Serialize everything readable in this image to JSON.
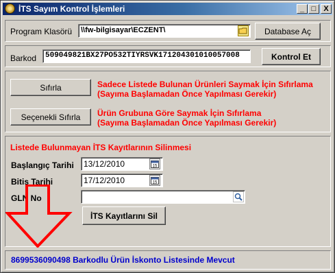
{
  "window": {
    "title": "İTS Sayım Kontrol İşlemleri",
    "minimize": "_",
    "maximize": "□",
    "close": "X"
  },
  "program": {
    "label": "Program Klasörü",
    "path": "\\\\fw-bilgisayar\\ECZENT\\",
    "open_button": "Database Aç"
  },
  "barkod": {
    "label": "Barkod",
    "value": "509049821BX27PO532TIYRSVK171204301010057008",
    "check_button": "Kontrol Et"
  },
  "reset": {
    "reset_button": "Sıfırla",
    "reset_line1": "Sadece Listede Bulunan Ürünleri Saymak İçin Sıfırlama",
    "reset_line2": "(Sayıma Başlamadan Önce Yapılması Gerekir)",
    "selective_button": "Seçenekli Sıfırla",
    "selective_line1": "Ürün Grubuna Göre Saymak İçin Sıfırlama",
    "selective_line2": "(Sayıma Başlamadan Önce Yapılması Gerekir)"
  },
  "delete": {
    "heading": "Listede Bulunmayan İTS Kayıtlarının Silinmesi",
    "start_label": "Başlangıç Tarihi",
    "start_value": "13/12/2010",
    "end_label": "Bitiş Tarihi",
    "end_value": "17/12/2010",
    "gln_label": "GLN No",
    "gln_value": "",
    "delete_button": "İTS Kayıtlarını Sil",
    "calendar_icon": "calendar-icon",
    "search_icon": "magnifier-icon",
    "arrow_color": "#ff0000"
  },
  "status": {
    "message": "8699536090498 Barkodlu Ürün İskonto Listesinde Mevcut"
  }
}
